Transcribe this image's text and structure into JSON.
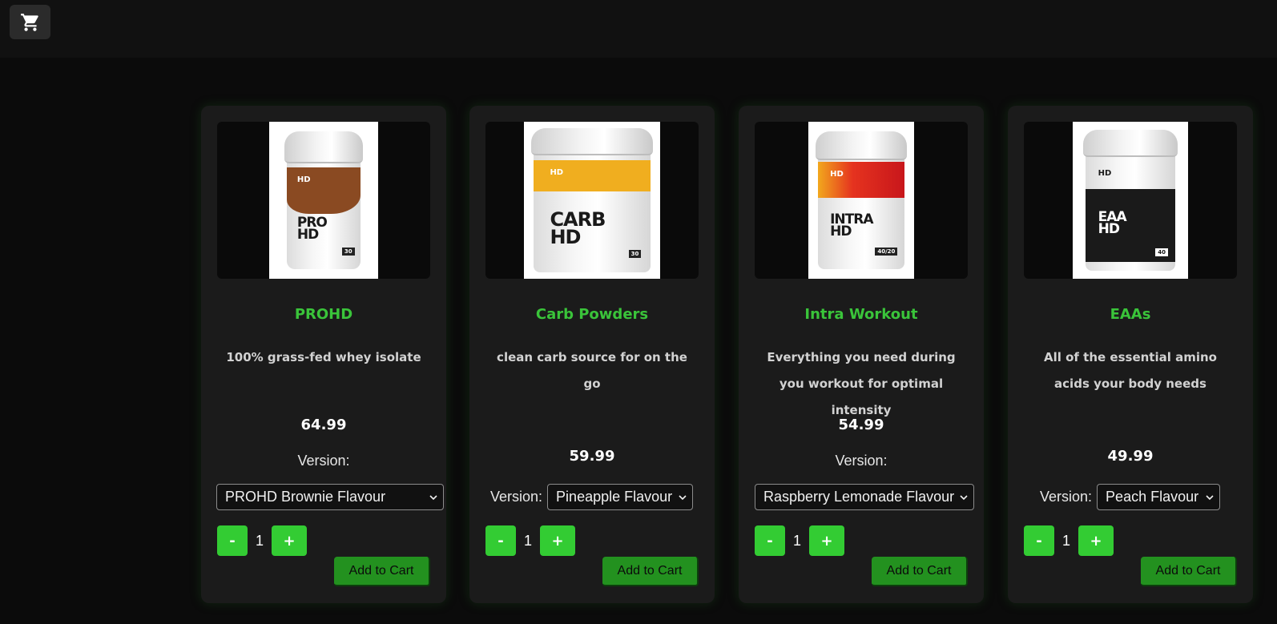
{
  "header": {
    "cart_icon": "cart-icon"
  },
  "colors": {
    "accent_green": "#3ac43a",
    "button_green": "#33cc33",
    "add_to_cart_green": "#23911f",
    "card_bg": "#1b1b1b",
    "page_bg": "#0b0b0b"
  },
  "products": [
    {
      "name": "PROHD",
      "description": "100% grass-fed whey isolate",
      "price": "64.99",
      "version_label": "Version:",
      "selected_version": "PROHD Brownie Flavour",
      "quantity": "1",
      "minus_label": "-",
      "plus_label": "+",
      "add_to_cart_label": "Add to Cart",
      "package": {
        "brand": "HD",
        "product_line": "PRO HD",
        "serving_count": "30",
        "band_color": "#8a4a22"
      }
    },
    {
      "name": "Carb Powders",
      "description": "clean carb source for on the go",
      "price": "59.99",
      "version_label": "Version:",
      "selected_version": "Pineapple Flavour",
      "quantity": "1",
      "minus_label": "-",
      "plus_label": "+",
      "add_to_cart_label": "Add to Cart",
      "package": {
        "brand": "HD",
        "product_line": "CARB HD",
        "serving_count": "30",
        "band_color": "#f0ae1f"
      }
    },
    {
      "name": "Intra Workout",
      "description": "Everything you need during you workout for optimal intensity",
      "price": "54.99",
      "version_label": "Version:",
      "selected_version": "Raspberry Lemonade Flavour",
      "quantity": "1",
      "minus_label": "-",
      "plus_label": "+",
      "add_to_cart_label": "Add to Cart",
      "package": {
        "brand": "HD",
        "product_line": "INTRA HD",
        "serving_count": "40/20",
        "band_color": "#d82a22"
      }
    },
    {
      "name": "EAAs",
      "description": "All of the essential amino acids your body needs",
      "price": "49.99",
      "version_label": "Version:",
      "selected_version": "Peach Flavour",
      "quantity": "1",
      "minus_label": "-",
      "plus_label": "+",
      "add_to_cart_label": "Add to Cart",
      "package": {
        "brand": "HD",
        "product_line": "EAA HD",
        "serving_count": "40",
        "band_color": "#1a1a1a"
      }
    }
  ]
}
